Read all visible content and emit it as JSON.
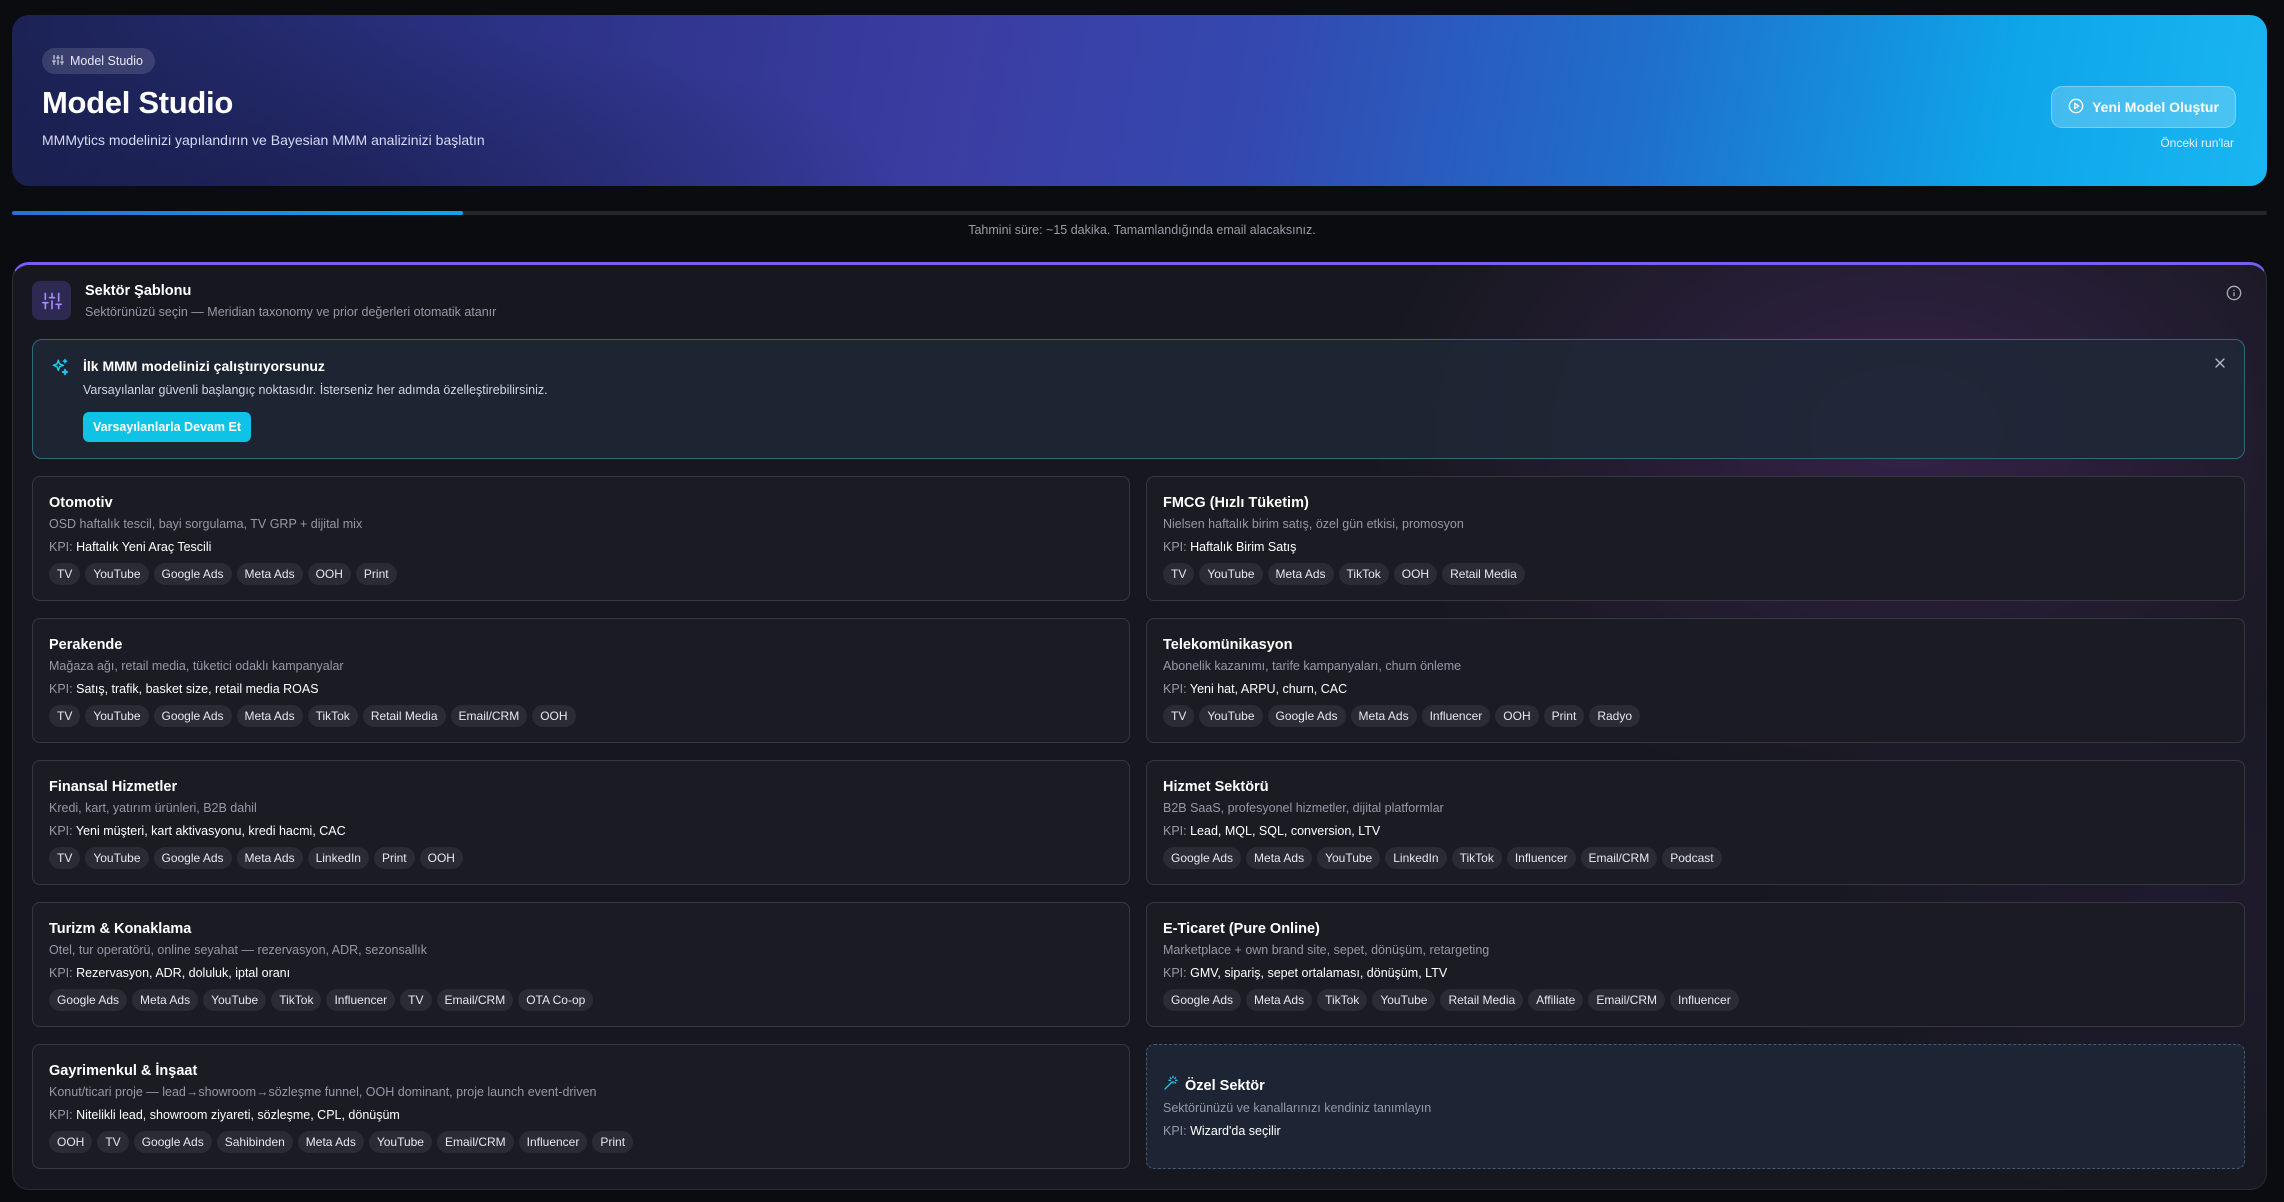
{
  "header": {
    "badge": "Model Studio",
    "badge_icon": "sliders-icon",
    "title": "Model Studio",
    "subtitle": "MMMytics modelinizi yapılandırın ve Bayesian MMM analizinizi başlatın",
    "primary_button": "Yeni Model Oluştur",
    "primary_button_icon": "play-circle-icon",
    "secondary_link": "Önceki run'lar"
  },
  "progress": {
    "fraction": 0.2,
    "note": "Tahmini süre: ~15 dakika. Tamamlandığında email alacaksınız."
  },
  "panel": {
    "icon": "sliders-vertical-icon",
    "title": "Sektör Şablonu",
    "subtitle": "Sektörünüzü seçin — Meridian taxonomy ve prior değerleri otomatik atanır",
    "info_icon": "info-icon"
  },
  "banner": {
    "icon": "sparkles-icon",
    "title": "İlk MMM modelinizi çalıştırıyorsunuz",
    "text": "Varsayılanlar güvenli başlangıç noktasıdır. İsterseniz her adımda özelleştirebilirsiniz.",
    "button": "Varsayılanlarla Devam Et",
    "close_icon": "close-icon"
  },
  "kpi_label": "KPI:",
  "sectors": [
    {
      "title": "Otomotiv",
      "description": "OSD haftalık tescil, bayi sorgulama, TV GRP + dijital mix",
      "kpi": "Haftalık Yeni Araç Tescili",
      "channels": [
        "TV",
        "YouTube",
        "Google Ads",
        "Meta Ads",
        "OOH",
        "Print"
      ]
    },
    {
      "title": "FMCG (Hızlı Tüketim)",
      "description": "Nielsen haftalık birim satış, özel gün etkisi, promosyon",
      "kpi": "Haftalık Birim Satış",
      "channels": [
        "TV",
        "YouTube",
        "Meta Ads",
        "TikTok",
        "OOH",
        "Retail Media"
      ]
    },
    {
      "title": "Perakende",
      "description": "Mağaza ağı, retail media, tüketici odaklı kampanyalar",
      "kpi": "Satış, trafik, basket size, retail media ROAS",
      "channels": [
        "TV",
        "YouTube",
        "Google Ads",
        "Meta Ads",
        "TikTok",
        "Retail Media",
        "Email/CRM",
        "OOH"
      ]
    },
    {
      "title": "Telekomünikasyon",
      "description": "Abonelik kazanımı, tarife kampanyaları, churn önleme",
      "kpi": "Yeni hat, ARPU, churn, CAC",
      "channels": [
        "TV",
        "YouTube",
        "Google Ads",
        "Meta Ads",
        "Influencer",
        "OOH",
        "Print",
        "Radyo"
      ]
    },
    {
      "title": "Finansal Hizmetler",
      "description": "Kredi, kart, yatırım ürünleri, B2B dahil",
      "kpi": "Yeni müşteri, kart aktivasyonu, kredi hacmi, CAC",
      "channels": [
        "TV",
        "YouTube",
        "Google Ads",
        "Meta Ads",
        "LinkedIn",
        "Print",
        "OOH"
      ]
    },
    {
      "title": "Hizmet Sektörü",
      "description": "B2B SaaS, profesyonel hizmetler, dijital platformlar",
      "kpi": "Lead, MQL, SQL, conversion, LTV",
      "channels": [
        "Google Ads",
        "Meta Ads",
        "YouTube",
        "LinkedIn",
        "TikTok",
        "Influencer",
        "Email/CRM",
        "Podcast"
      ]
    },
    {
      "title": "Turizm & Konaklama",
      "description": "Otel, tur operatörü, online seyahat — rezervasyon, ADR, sezonsallık",
      "kpi": "Rezervasyon, ADR, doluluk, iptal oranı",
      "channels": [
        "Google Ads",
        "Meta Ads",
        "YouTube",
        "TikTok",
        "Influencer",
        "TV",
        "Email/CRM",
        "OTA Co-op"
      ]
    },
    {
      "title": "E-Ticaret (Pure Online)",
      "description": "Marketplace + own brand site, sepet, dönüşüm, retargeting",
      "kpi": "GMV, sipariş, sepet ortalaması, dönüşüm, LTV",
      "channels": [
        "Google Ads",
        "Meta Ads",
        "TikTok",
        "YouTube",
        "Retail Media",
        "Affiliate",
        "Email/CRM",
        "Influencer"
      ]
    },
    {
      "title": "Gayrimenkul & İnşaat",
      "description": "Konut/ticari proje — lead→showroom→sözleşme funnel, OOH dominant, proje launch event-driven",
      "kpi": "Nitelikli lead, showroom ziyareti, sözleşme, CPL, dönüşüm",
      "channels": [
        "OOH",
        "TV",
        "Google Ads",
        "Sahibinden",
        "Meta Ads",
        "YouTube",
        "Email/CRM",
        "Influencer",
        "Print"
      ]
    }
  ],
  "custom_sector": {
    "icon": "magic-wand-icon",
    "title": "Özel Sektör",
    "description": "Sektörünüzü ve kanallarınızı kendiniz tanımlayın",
    "kpi": "Wizard'da seçilir"
  },
  "colors": {
    "accent": "#0ea5e9",
    "cta": "#0fc3e6",
    "purple": "#7b5cf0"
  }
}
